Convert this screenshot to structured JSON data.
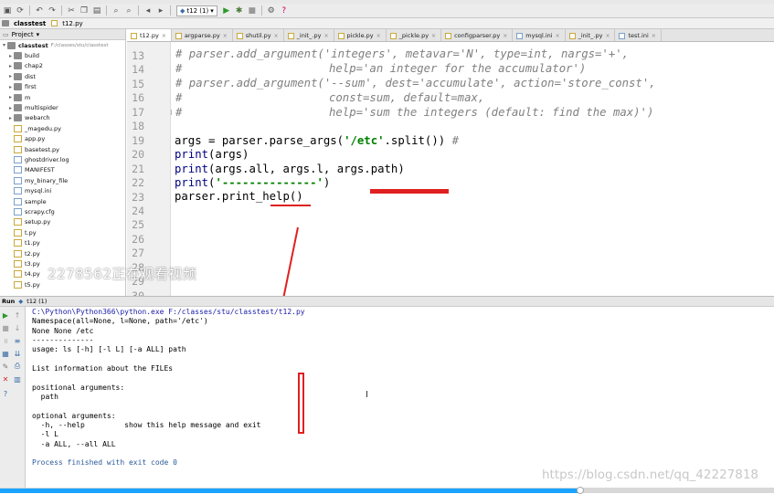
{
  "toolbar": {
    "run_config": "t12 (1)"
  },
  "breadcrumb": {
    "project": "classtest",
    "file": "t12.py"
  },
  "project_panel": {
    "title": "Project",
    "root_name": "classtest",
    "root_path": "F:/classes/stu/classtest",
    "items": [
      {
        "label": "build",
        "kind": "folder"
      },
      {
        "label": "chap2",
        "kind": "folder"
      },
      {
        "label": "dist",
        "kind": "folder"
      },
      {
        "label": "first",
        "kind": "folder"
      },
      {
        "label": "m",
        "kind": "folder"
      },
      {
        "label": "multispider",
        "kind": "folder"
      },
      {
        "label": "webarch",
        "kind": "folder"
      },
      {
        "label": "_magedu.py",
        "kind": "py"
      },
      {
        "label": "app.py",
        "kind": "py"
      },
      {
        "label": "basetest.py",
        "kind": "py"
      },
      {
        "label": "ghostdriver.log",
        "kind": "file"
      },
      {
        "label": "MANIFEST",
        "kind": "file"
      },
      {
        "label": "my_binary_file",
        "kind": "file"
      },
      {
        "label": "mysql.ini",
        "kind": "file"
      },
      {
        "label": "sample",
        "kind": "file"
      },
      {
        "label": "scrapy.cfg",
        "kind": "file"
      },
      {
        "label": "setup.py",
        "kind": "py"
      },
      {
        "label": "t.py",
        "kind": "py"
      },
      {
        "label": "t1.py",
        "kind": "py"
      },
      {
        "label": "t2.py",
        "kind": "py"
      },
      {
        "label": "t3.py",
        "kind": "py"
      },
      {
        "label": "t4.py",
        "kind": "py"
      },
      {
        "label": "t5.py",
        "kind": "py"
      }
    ]
  },
  "tabs": [
    {
      "label": "t12.py",
      "active": true
    },
    {
      "label": "argparse.py",
      "active": false
    },
    {
      "label": "shutil.py",
      "active": false
    },
    {
      "label": "_init_.py",
      "active": false
    },
    {
      "label": "pickle.py",
      "active": false
    },
    {
      "label": "_pickle.py",
      "active": false
    },
    {
      "label": "configparser.py",
      "active": false
    },
    {
      "label": "mysql.ini",
      "active": false
    },
    {
      "label": "_init_.py",
      "active": false
    },
    {
      "label": "test.ini",
      "active": false
    }
  ],
  "editor": {
    "line_numbers": [
      "13",
      "14",
      "15",
      "16",
      "17",
      "18",
      "19",
      "20",
      "21",
      "22",
      "23",
      "24",
      "25",
      "26",
      "27",
      "28",
      "29",
      "30"
    ],
    "code": {
      "l13": "# parser.add_argument('integers', metavar='N', type=int, nargs='+',",
      "l14_a": "#",
      "l14_b": "help='an integer for the accumulator')",
      "l15": "# parser.add_argument('--sum', dest='accumulate', action='store_const',",
      "l16_a": "#",
      "l16_b": "const=sum, default=max,",
      "l17_a": "#",
      "l17_b": "help='sum the integers (default: find the max)')",
      "l19_a": "args = parser.parse_args(",
      "l19_b": "'/etc'",
      "l19_c": ".split()) ",
      "l19_d": "#",
      "l20_a": "print",
      "l20_b": "(args)",
      "l21_a": "print",
      "l21_b": "(args.all, args.l, args.path)",
      "l22_a": "print",
      "l22_b": "(",
      "l22_c": "'--------------'",
      "l22_d": ")",
      "l23": "parser.print_help()"
    }
  },
  "overlay_watermark": "2278562正在观看视频",
  "run_panel": {
    "label": "Run",
    "config": "t12 (1)",
    "output": [
      "C:\\Python\\Python366\\python.exe F:/classes/stu/classtest/t12.py",
      "Namespace(all=None, l=None, path='/etc')",
      "None None /etc",
      "--------------",
      "usage: ls [-h] [-l L] [-a ALL] path",
      "",
      "List information about the FILEs",
      "",
      "positional arguments:",
      "  path",
      "",
      "optional arguments:",
      "  -h, --help         show this help message and exit",
      "  -l L",
      "  -a ALL, --all ALL",
      "",
      "Process finished with exit code 0"
    ]
  },
  "site_watermark": "https://blog.csdn.net/qq_42227818",
  "video_progress": 0.75,
  "colors": {
    "annotation_red": "#e02020",
    "progress_blue": "#1aa3ff",
    "string_green": "#008000",
    "comment_gray": "#808080",
    "keyword_navy": "#000080"
  }
}
